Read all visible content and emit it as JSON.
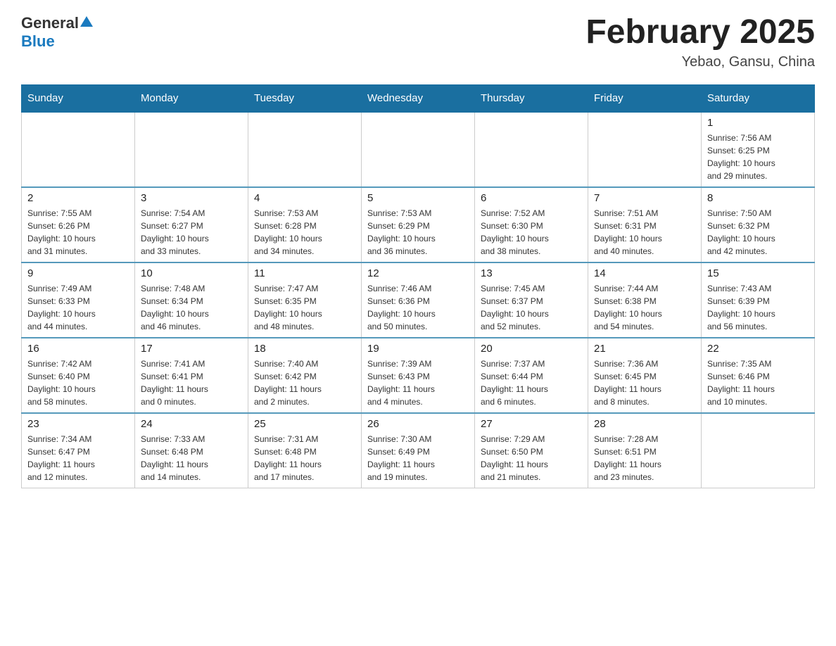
{
  "header": {
    "logo": {
      "general": "General",
      "blue": "Blue"
    },
    "title": "February 2025",
    "location": "Yebao, Gansu, China"
  },
  "days_of_week": [
    "Sunday",
    "Monday",
    "Tuesday",
    "Wednesday",
    "Thursday",
    "Friday",
    "Saturday"
  ],
  "weeks": [
    {
      "days": [
        {
          "date": "",
          "info": "",
          "empty": true
        },
        {
          "date": "",
          "info": "",
          "empty": true
        },
        {
          "date": "",
          "info": "",
          "empty": true
        },
        {
          "date": "",
          "info": "",
          "empty": true
        },
        {
          "date": "",
          "info": "",
          "empty": true
        },
        {
          "date": "",
          "info": "",
          "empty": true
        },
        {
          "date": "1",
          "info": "Sunrise: 7:56 AM\nSunset: 6:25 PM\nDaylight: 10 hours\nand 29 minutes.",
          "empty": false
        }
      ]
    },
    {
      "days": [
        {
          "date": "2",
          "info": "Sunrise: 7:55 AM\nSunset: 6:26 PM\nDaylight: 10 hours\nand 31 minutes.",
          "empty": false
        },
        {
          "date": "3",
          "info": "Sunrise: 7:54 AM\nSunset: 6:27 PM\nDaylight: 10 hours\nand 33 minutes.",
          "empty": false
        },
        {
          "date": "4",
          "info": "Sunrise: 7:53 AM\nSunset: 6:28 PM\nDaylight: 10 hours\nand 34 minutes.",
          "empty": false
        },
        {
          "date": "5",
          "info": "Sunrise: 7:53 AM\nSunset: 6:29 PM\nDaylight: 10 hours\nand 36 minutes.",
          "empty": false
        },
        {
          "date": "6",
          "info": "Sunrise: 7:52 AM\nSunset: 6:30 PM\nDaylight: 10 hours\nand 38 minutes.",
          "empty": false
        },
        {
          "date": "7",
          "info": "Sunrise: 7:51 AM\nSunset: 6:31 PM\nDaylight: 10 hours\nand 40 minutes.",
          "empty": false
        },
        {
          "date": "8",
          "info": "Sunrise: 7:50 AM\nSunset: 6:32 PM\nDaylight: 10 hours\nand 42 minutes.",
          "empty": false
        }
      ]
    },
    {
      "days": [
        {
          "date": "9",
          "info": "Sunrise: 7:49 AM\nSunset: 6:33 PM\nDaylight: 10 hours\nand 44 minutes.",
          "empty": false
        },
        {
          "date": "10",
          "info": "Sunrise: 7:48 AM\nSunset: 6:34 PM\nDaylight: 10 hours\nand 46 minutes.",
          "empty": false
        },
        {
          "date": "11",
          "info": "Sunrise: 7:47 AM\nSunset: 6:35 PM\nDaylight: 10 hours\nand 48 minutes.",
          "empty": false
        },
        {
          "date": "12",
          "info": "Sunrise: 7:46 AM\nSunset: 6:36 PM\nDaylight: 10 hours\nand 50 minutes.",
          "empty": false
        },
        {
          "date": "13",
          "info": "Sunrise: 7:45 AM\nSunset: 6:37 PM\nDaylight: 10 hours\nand 52 minutes.",
          "empty": false
        },
        {
          "date": "14",
          "info": "Sunrise: 7:44 AM\nSunset: 6:38 PM\nDaylight: 10 hours\nand 54 minutes.",
          "empty": false
        },
        {
          "date": "15",
          "info": "Sunrise: 7:43 AM\nSunset: 6:39 PM\nDaylight: 10 hours\nand 56 minutes.",
          "empty": false
        }
      ]
    },
    {
      "days": [
        {
          "date": "16",
          "info": "Sunrise: 7:42 AM\nSunset: 6:40 PM\nDaylight: 10 hours\nand 58 minutes.",
          "empty": false
        },
        {
          "date": "17",
          "info": "Sunrise: 7:41 AM\nSunset: 6:41 PM\nDaylight: 11 hours\nand 0 minutes.",
          "empty": false
        },
        {
          "date": "18",
          "info": "Sunrise: 7:40 AM\nSunset: 6:42 PM\nDaylight: 11 hours\nand 2 minutes.",
          "empty": false
        },
        {
          "date": "19",
          "info": "Sunrise: 7:39 AM\nSunset: 6:43 PM\nDaylight: 11 hours\nand 4 minutes.",
          "empty": false
        },
        {
          "date": "20",
          "info": "Sunrise: 7:37 AM\nSunset: 6:44 PM\nDaylight: 11 hours\nand 6 minutes.",
          "empty": false
        },
        {
          "date": "21",
          "info": "Sunrise: 7:36 AM\nSunset: 6:45 PM\nDaylight: 11 hours\nand 8 minutes.",
          "empty": false
        },
        {
          "date": "22",
          "info": "Sunrise: 7:35 AM\nSunset: 6:46 PM\nDaylight: 11 hours\nand 10 minutes.",
          "empty": false
        }
      ]
    },
    {
      "days": [
        {
          "date": "23",
          "info": "Sunrise: 7:34 AM\nSunset: 6:47 PM\nDaylight: 11 hours\nand 12 minutes.",
          "empty": false
        },
        {
          "date": "24",
          "info": "Sunrise: 7:33 AM\nSunset: 6:48 PM\nDaylight: 11 hours\nand 14 minutes.",
          "empty": false
        },
        {
          "date": "25",
          "info": "Sunrise: 7:31 AM\nSunset: 6:48 PM\nDaylight: 11 hours\nand 17 minutes.",
          "empty": false
        },
        {
          "date": "26",
          "info": "Sunrise: 7:30 AM\nSunset: 6:49 PM\nDaylight: 11 hours\nand 19 minutes.",
          "empty": false
        },
        {
          "date": "27",
          "info": "Sunrise: 7:29 AM\nSunset: 6:50 PM\nDaylight: 11 hours\nand 21 minutes.",
          "empty": false
        },
        {
          "date": "28",
          "info": "Sunrise: 7:28 AM\nSunset: 6:51 PM\nDaylight: 11 hours\nand 23 minutes.",
          "empty": false
        },
        {
          "date": "",
          "info": "",
          "empty": true
        }
      ]
    }
  ]
}
